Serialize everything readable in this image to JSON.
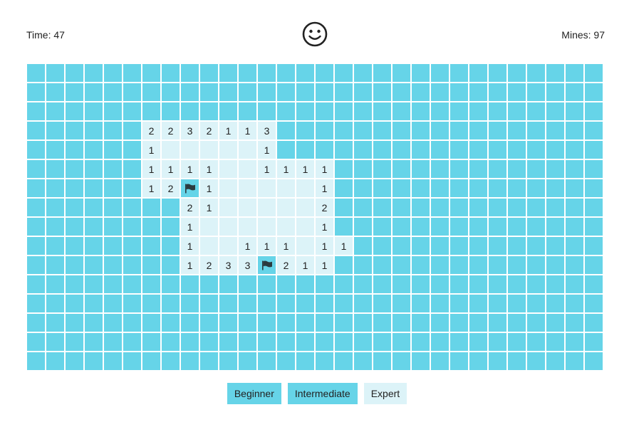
{
  "status": {
    "time_label": "Time: 47",
    "mines_label": "Mines: 97",
    "face": "smiley-face-icon"
  },
  "colors": {
    "hidden_cell": "#66d4e8",
    "revealed_cell": "#dcf3f8",
    "text": "#222222"
  },
  "board": {
    "columns": 30,
    "rows": 16,
    "legend": {
      "#": "hidden",
      ".": "revealed-empty",
      "F": "flag",
      "1-8": "revealed-number"
    },
    "grid": [
      "##############################",
      "##############################",
      "##############################",
      "######2232113#################",
      "######1.....1#################",
      "######1111..1111##############",
      "######12F1.....1##############",
      "########21.....2##############",
      "########1......1##############",
      "########1..111.11#############",
      "########1233F211##############",
      "##############################",
      "##############################",
      "##############################",
      "##############################",
      "##############################"
    ]
  },
  "levels": [
    {
      "label": "Beginner",
      "style": "solid"
    },
    {
      "label": "Intermediate",
      "style": "solid"
    },
    {
      "label": "Expert",
      "style": "light"
    }
  ]
}
